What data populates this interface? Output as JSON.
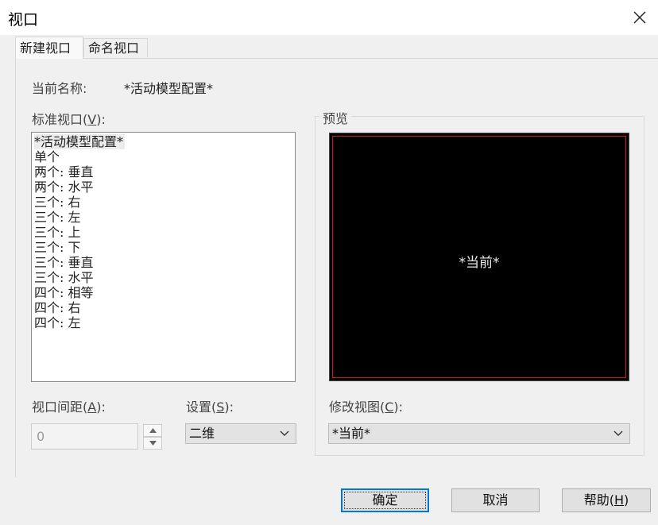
{
  "window": {
    "title": "视口"
  },
  "tabs": [
    {
      "label": "新建视口",
      "active": true
    },
    {
      "label": "命名视口",
      "active": false
    }
  ],
  "current_name": {
    "label": "当前名称:",
    "value": "*活动模型配置*"
  },
  "standard_viewports": {
    "label_pre": "标准视口(",
    "label_key": "V",
    "label_post": "):",
    "items": [
      "*活动模型配置*",
      "单个",
      "两个: 垂直",
      "两个: 水平",
      "三个: 右",
      "三个: 左",
      "三个: 上",
      "三个: 下",
      "三个: 垂直",
      "三个: 水平",
      "四个: 相等",
      "四个: 右",
      "四个: 左"
    ],
    "selected_index": 0
  },
  "preview": {
    "label": "预览",
    "text": "*当前*"
  },
  "viewport_spacing": {
    "label_pre": "视口间距(",
    "label_key": "A",
    "label_post": "):",
    "value": "0"
  },
  "setup": {
    "label_pre": "设置(",
    "label_key": "S",
    "label_post": "):",
    "value": "二维"
  },
  "change_view": {
    "label_pre": "修改视图(",
    "label_key": "C",
    "label_post": "):",
    "value": "*当前*"
  },
  "buttons": {
    "ok": "确定",
    "cancel": "取消",
    "help_pre": "帮助(",
    "help_key": "H",
    "help_post": ")"
  },
  "colors": {
    "preview_background": "#000000",
    "preview_border": "#d01818",
    "focus_blue": "#0078d7"
  }
}
